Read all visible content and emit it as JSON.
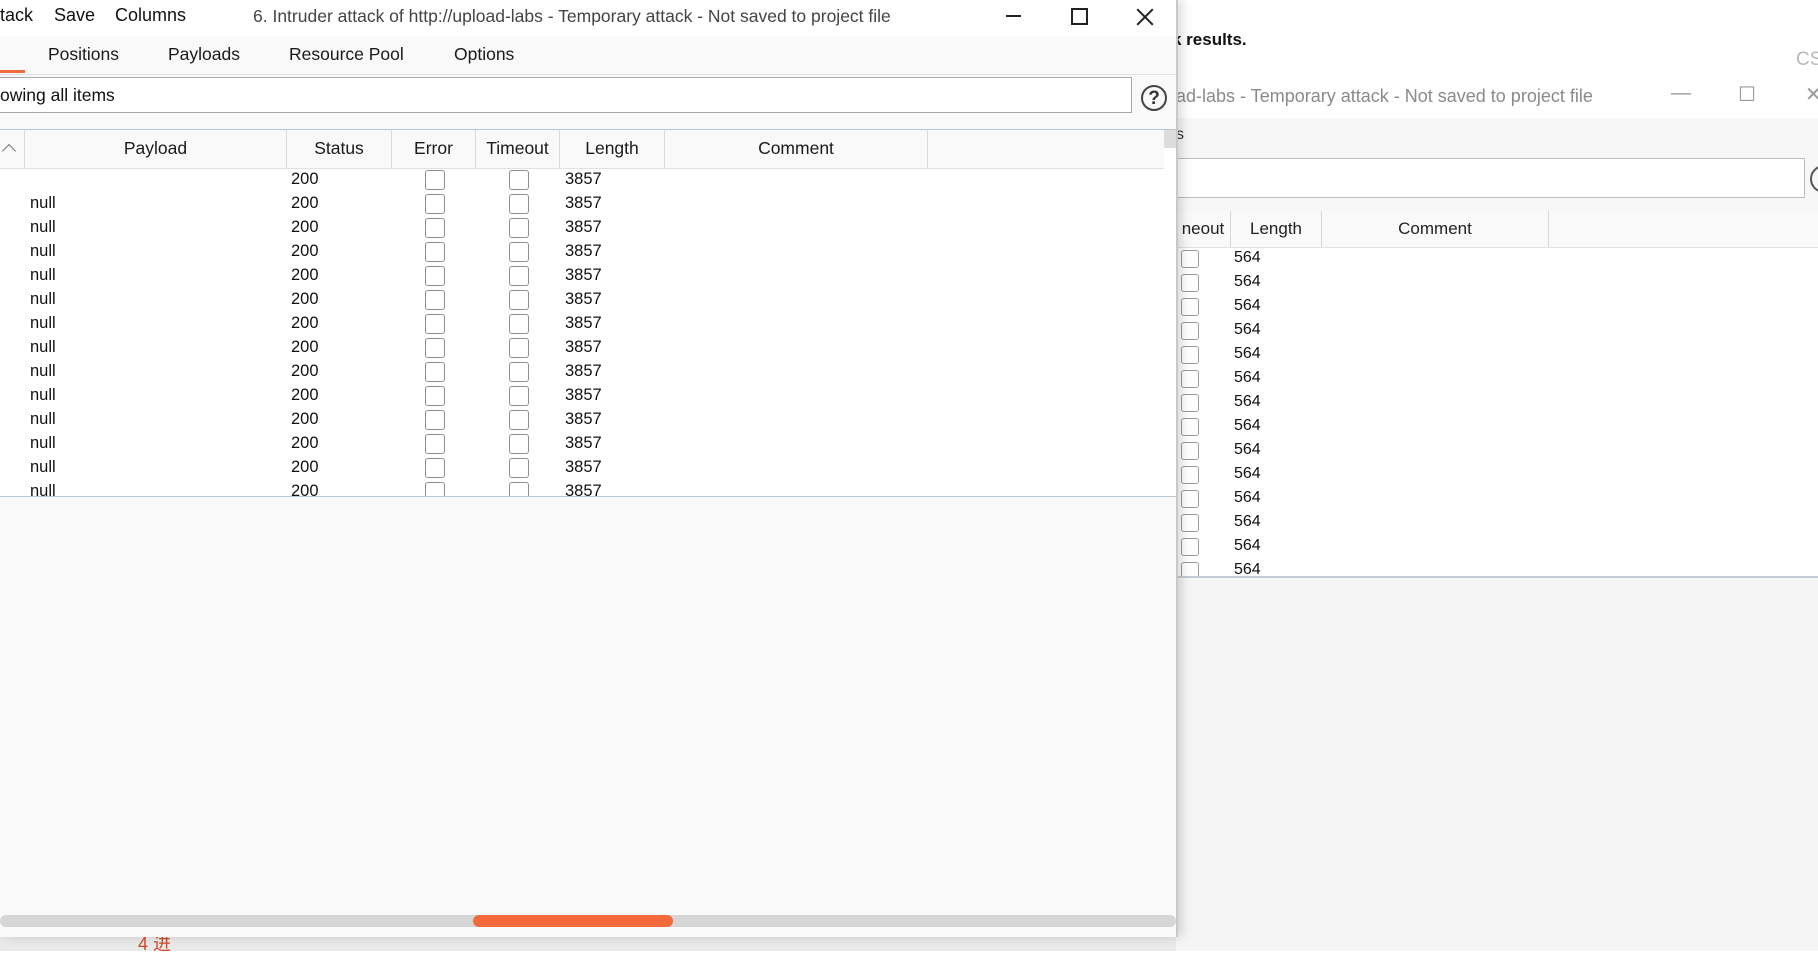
{
  "background_window": {
    "results_text": "k results.",
    "cs_text": "CS",
    "title": "ad-labs - Temporary attack - Not saved to project file",
    "tab_fragment": "s",
    "columns": [
      "neout",
      "Length",
      "Comment"
    ],
    "length_values": [
      "564",
      "564",
      "564",
      "564",
      "564",
      "564",
      "564",
      "564",
      "564",
      "564",
      "564",
      "564",
      "564",
      "564"
    ]
  },
  "menu": {
    "attack": "tack",
    "save": "Save",
    "columns": "Columns"
  },
  "window": {
    "title": "6. Intruder attack of http://upload-labs - Temporary attack - Not saved to project file",
    "minimize_glyph": "—",
    "maximize_glyph": "☐",
    "close_glyph": "✕"
  },
  "tabs": [
    "Positions",
    "Payloads",
    "Resource Pool",
    "Options"
  ],
  "filter": {
    "text": "owing all items",
    "help_glyph": "?"
  },
  "table": {
    "columns": [
      "Payload",
      "Status",
      "Error",
      "Timeout",
      "Length",
      "Comment"
    ],
    "rows": [
      {
        "payload": "",
        "status": "200",
        "length": "3857"
      },
      {
        "payload": "null",
        "status": "200",
        "length": "3857"
      },
      {
        "payload": "null",
        "status": "200",
        "length": "3857"
      },
      {
        "payload": "null",
        "status": "200",
        "length": "3857"
      },
      {
        "payload": "null",
        "status": "200",
        "length": "3857"
      },
      {
        "payload": "null",
        "status": "200",
        "length": "3857"
      },
      {
        "payload": "null",
        "status": "200",
        "length": "3857"
      },
      {
        "payload": "null",
        "status": "200",
        "length": "3857"
      },
      {
        "payload": "null",
        "status": "200",
        "length": "3857"
      },
      {
        "payload": "null",
        "status": "200",
        "length": "3857"
      },
      {
        "payload": "null",
        "status": "200",
        "length": "3857"
      },
      {
        "payload": "null",
        "status": "200",
        "length": "3857"
      },
      {
        "payload": "null",
        "status": "200",
        "length": "3857"
      },
      {
        "payload": "null",
        "status": "200",
        "length": "3857"
      }
    ]
  },
  "colors": {
    "accent": "#f26a3a"
  },
  "bottom_fragment": "4 进"
}
